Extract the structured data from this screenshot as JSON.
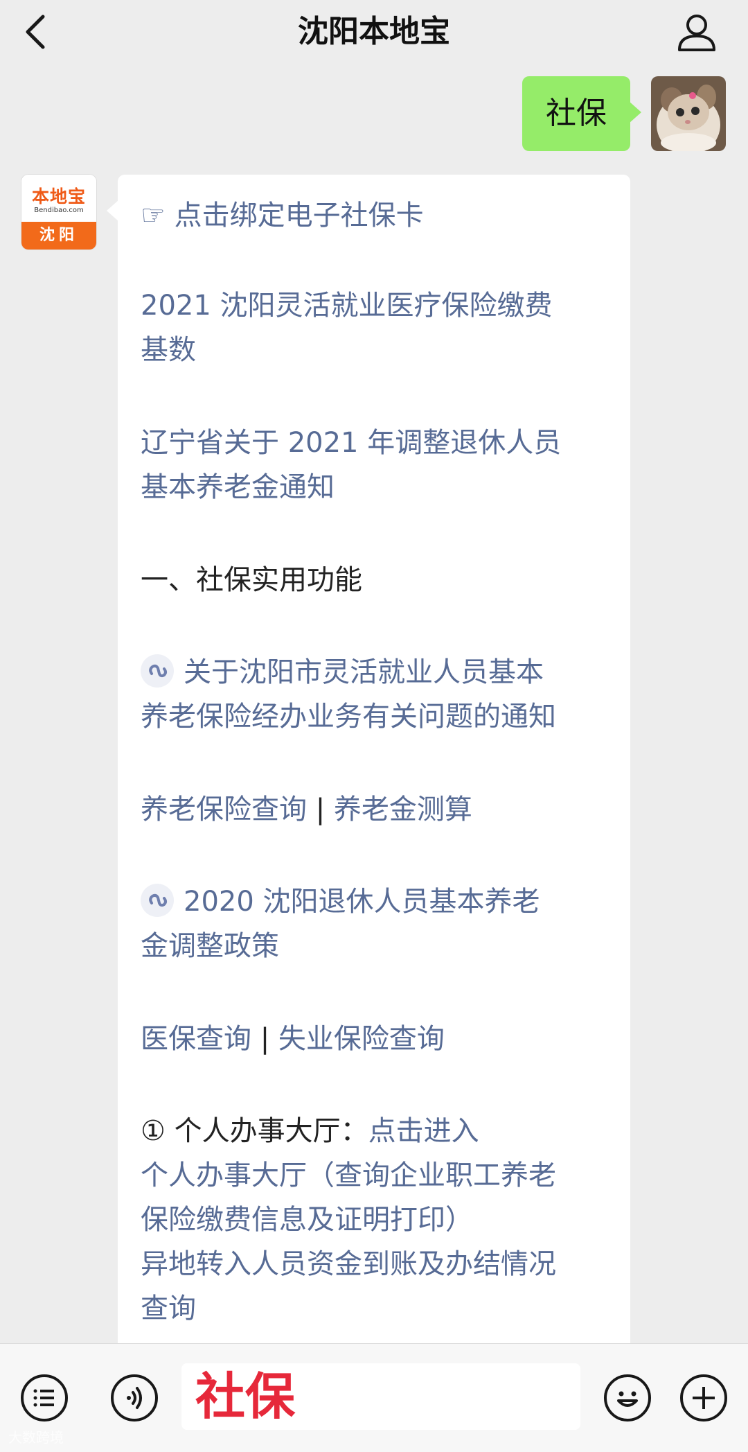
{
  "header": {
    "title": "沈阳本地宝"
  },
  "outgoing": {
    "text": "社保"
  },
  "brand": {
    "logo_text": "本地宝",
    "site": "Bendibao.com",
    "city": "沈阳"
  },
  "message": {
    "line1": "☞ 点击绑定电子社保卡",
    "item2a": "2021 沈阳灵活就业医疗保险缴费",
    "item2b": "基数",
    "item3a": "辽宁省关于 2021 年调整退休人员",
    "item3b": "基本养老金通知",
    "section1": "一、社保实用功能",
    "link1a": "关于沈阳市灵活就业人员基本",
    "link1b": "养老保险经办业务有关问题的通知",
    "query1a": "养老保险查询",
    "sep1": " | ",
    "query1b": "养老金测算",
    "link2a": "2020 沈阳退休人员基本养老",
    "link2b": "金调整政策",
    "query2a": "医保查询",
    "sep2": " | ",
    "query2b": "失业保险查询",
    "hall_prefix": "① 个人办事大厅：",
    "hall_link": "点击进入",
    "hall_line1": "个人办事大厅（查询企业职工养老",
    "hall_line2": "保险缴费信息及证明打印）",
    "hall_line3": "异地转入人员资金到账及办结情况",
    "hall_line4": "查询"
  },
  "input": {
    "value": "社保"
  },
  "watermark": "大数跨境",
  "icons": [
    "back-icon",
    "profile-icon",
    "mini-program-icon",
    "menu-icon",
    "voice-icon",
    "emoji-icon",
    "plus-icon"
  ],
  "colors": {
    "link": "#576b95",
    "outgoing_bubble": "#95ec69",
    "brand": "#f26a1a"
  }
}
